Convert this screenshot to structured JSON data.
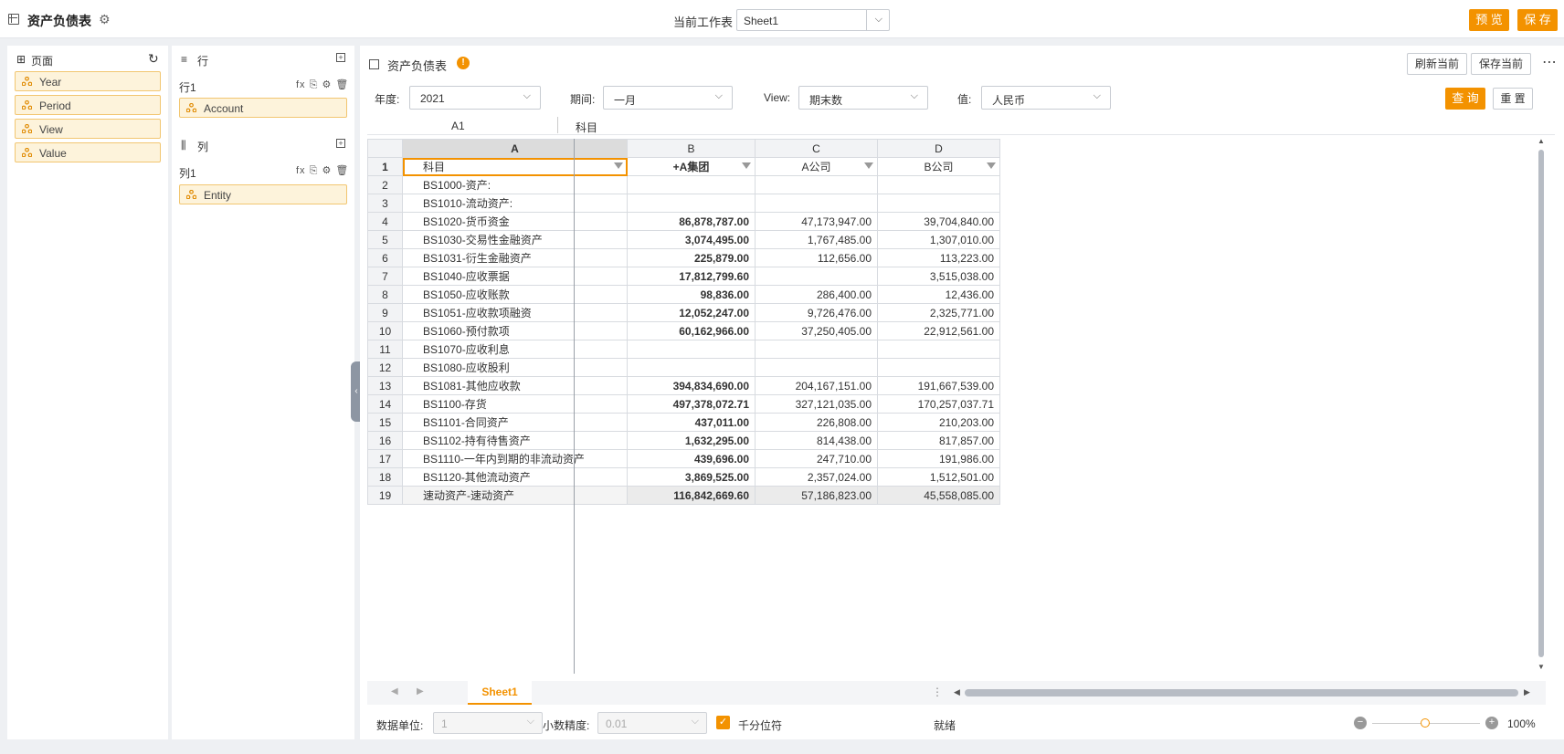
{
  "topbar": {
    "title": "资产负债表",
    "worksheet_label": "当前工作表",
    "worksheet_value": "Sheet1",
    "preview_label": "预 览",
    "save_label": "保 存"
  },
  "page_panel": {
    "title": "页面",
    "fields": [
      "Year",
      "Period",
      "View",
      "Value"
    ]
  },
  "row_col_panel": {
    "rows_title": "行",
    "row1_label": "行1",
    "row1_field": "Account",
    "cols_title": "列",
    "col1_label": "列1",
    "col1_field": "Entity"
  },
  "main": {
    "title": "资产负债表",
    "refresh_label": "刷新当前",
    "save_current_label": "保存当前",
    "query_label": "查 询",
    "reset_label": "重 置",
    "filters": [
      {
        "label": "年度:",
        "value": "2021"
      },
      {
        "label": "期间:",
        "value": "一月"
      },
      {
        "label": "View:",
        "value": "期末数"
      },
      {
        "label": "值:",
        "value": "人民币"
      }
    ],
    "cell_ref": "A1",
    "cell_value": "科目"
  },
  "sheet": {
    "col_letters": [
      "A",
      "B",
      "C",
      "D"
    ],
    "header": [
      "科目",
      "+A集团",
      "A公司",
      "B公司"
    ],
    "rows": [
      {
        "n": "2",
        "a": "BS1000-资产:",
        "b": "",
        "c": "",
        "d": ""
      },
      {
        "n": "3",
        "a": "BS1010-流动资产:",
        "b": "",
        "c": "",
        "d": ""
      },
      {
        "n": "4",
        "a": "BS1020-货币资金",
        "b": "86,878,787.00",
        "c": "47,173,947.00",
        "d": "39,704,840.00"
      },
      {
        "n": "5",
        "a": "BS1030-交易性金融资产",
        "b": "3,074,495.00",
        "c": "1,767,485.00",
        "d": "1,307,010.00"
      },
      {
        "n": "6",
        "a": "BS1031-衍生金融资产",
        "b": "225,879.00",
        "c": "112,656.00",
        "d": "113,223.00"
      },
      {
        "n": "7",
        "a": "BS1040-应收票据",
        "b": "17,812,799.60",
        "c": "",
        "d": "3,515,038.00"
      },
      {
        "n": "8",
        "a": "BS1050-应收账款",
        "b": "98,836.00",
        "c": "286,400.00",
        "d": "12,436.00"
      },
      {
        "n": "9",
        "a": "BS1051-应收款项融资",
        "b": "12,052,247.00",
        "c": "9,726,476.00",
        "d": "2,325,771.00"
      },
      {
        "n": "10",
        "a": "BS1060-预付款项",
        "b": "60,162,966.00",
        "c": "37,250,405.00",
        "d": "22,912,561.00"
      },
      {
        "n": "11",
        "a": "BS1070-应收利息",
        "b": "",
        "c": "",
        "d": ""
      },
      {
        "n": "12",
        "a": "BS1080-应收股利",
        "b": "",
        "c": "",
        "d": ""
      },
      {
        "n": "13",
        "a": "BS1081-其他应收款",
        "b": "394,834,690.00",
        "c": "204,167,151.00",
        "d": "191,667,539.00"
      },
      {
        "n": "14",
        "a": "BS1100-存货",
        "b": "497,378,072.71",
        "c": "327,121,035.00",
        "d": "170,257,037.71"
      },
      {
        "n": "15",
        "a": "BS1101-合同资产",
        "b": "437,011.00",
        "c": "226,808.00",
        "d": "210,203.00"
      },
      {
        "n": "16",
        "a": "BS1102-持有待售资产",
        "b": "1,632,295.00",
        "c": "814,438.00",
        "d": "817,857.00"
      },
      {
        "n": "17",
        "a": "BS1110-一年内到期的非流动资产",
        "b": "439,696.00",
        "c": "247,710.00",
        "d": "191,986.00"
      },
      {
        "n": "18",
        "a": "BS1120-其他流动资产",
        "b": "3,869,525.00",
        "c": "2,357,024.00",
        "d": "1,512,501.00"
      },
      {
        "n": "19",
        "a": "速动资产-速动资产",
        "b": "116,842,669.60",
        "c": "57,186,823.00",
        "d": "45,558,085.00"
      }
    ]
  },
  "tabs": {
    "sheet_tab": "Sheet1"
  },
  "status": {
    "unit_label": "数据单位:",
    "unit_value": "1",
    "precision_label": "小数精度:",
    "precision_value": "0.01",
    "thousands_label": "千分位符",
    "ready": "就绪",
    "zoom": "100%"
  },
  "colors": {
    "accent": "#f39200",
    "chip_bg": "#fdf3db"
  }
}
